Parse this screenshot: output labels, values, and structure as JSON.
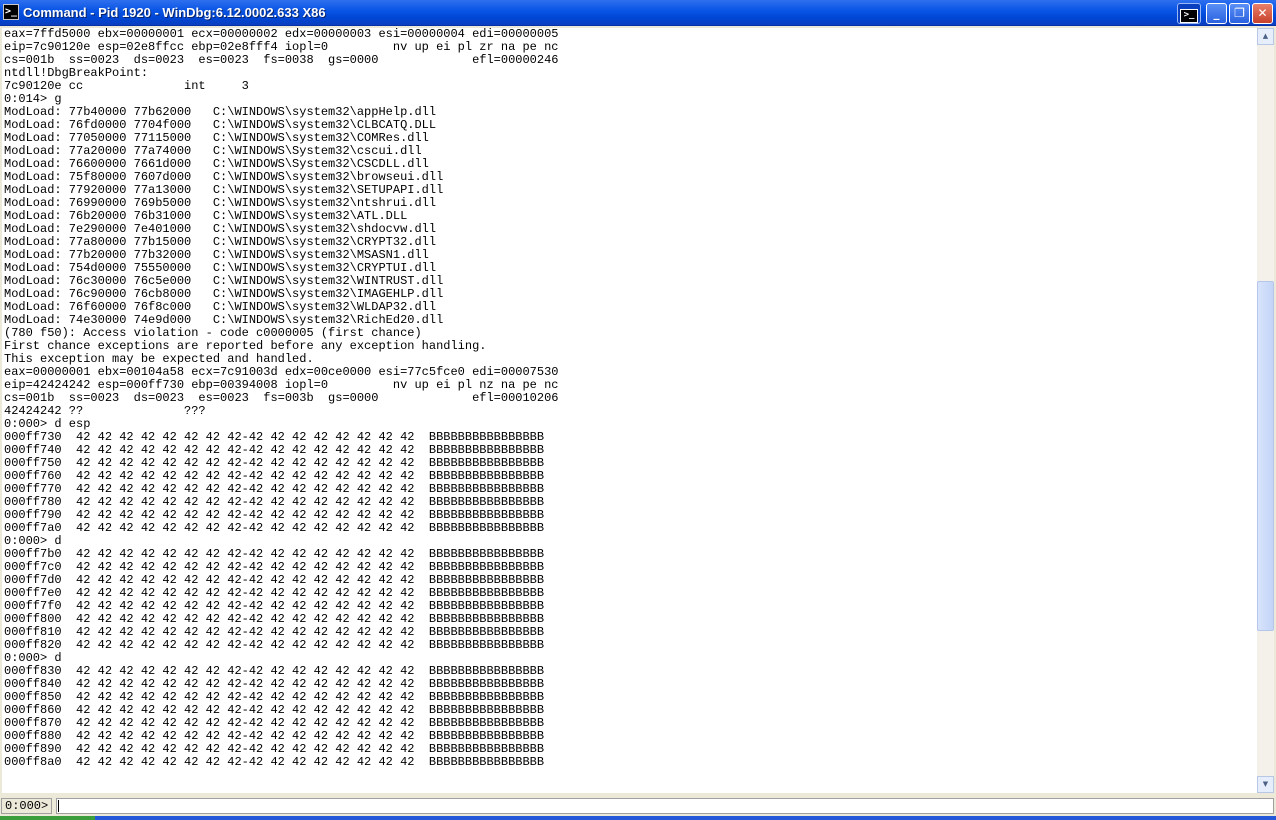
{
  "window": {
    "title": "Command - Pid 1920 - WinDbg:6.12.0002.633 X86",
    "app_icon": "command-prompt-icon"
  },
  "titlebar_buttons": {
    "cmd_glyph": ">_",
    "minimize": "_",
    "maximize": "❐",
    "close": "✕"
  },
  "scrollbar": {
    "up_arrow": "▲",
    "down_arrow": "▼",
    "thumb_position": 0.62
  },
  "output": {
    "lines": [
      "eax=7ffd5000 ebx=00000001 ecx=00000002 edx=00000003 esi=00000004 edi=00000005",
      "eip=7c90120e esp=02e8ffcc ebp=02e8fff4 iopl=0         nv up ei pl zr na pe nc",
      "cs=001b  ss=0023  ds=0023  es=0023  fs=0038  gs=0000             efl=00000246",
      "ntdll!DbgBreakPoint:",
      "7c90120e cc              int     3",
      "0:014> g",
      "ModLoad: 77b40000 77b62000   C:\\WINDOWS\\system32\\appHelp.dll",
      "ModLoad: 76fd0000 7704f000   C:\\WINDOWS\\system32\\CLBCATQ.DLL",
      "ModLoad: 77050000 77115000   C:\\WINDOWS\\system32\\COMRes.dll",
      "ModLoad: 77a20000 77a74000   C:\\WINDOWS\\System32\\cscui.dll",
      "ModLoad: 76600000 7661d000   C:\\WINDOWS\\System32\\CSCDLL.dll",
      "ModLoad: 75f80000 7607d000   C:\\WINDOWS\\system32\\browseui.dll",
      "ModLoad: 77920000 77a13000   C:\\WINDOWS\\system32\\SETUPAPI.dll",
      "ModLoad: 76990000 769b5000   C:\\WINDOWS\\system32\\ntshrui.dll",
      "ModLoad: 76b20000 76b31000   C:\\WINDOWS\\system32\\ATL.DLL",
      "ModLoad: 7e290000 7e401000   C:\\WINDOWS\\system32\\shdocvw.dll",
      "ModLoad: 77a80000 77b15000   C:\\WINDOWS\\system32\\CRYPT32.dll",
      "ModLoad: 77b20000 77b32000   C:\\WINDOWS\\system32\\MSASN1.dll",
      "ModLoad: 754d0000 75550000   C:\\WINDOWS\\system32\\CRYPTUI.dll",
      "ModLoad: 76c30000 76c5e000   C:\\WINDOWS\\system32\\WINTRUST.dll",
      "ModLoad: 76c90000 76cb8000   C:\\WINDOWS\\system32\\IMAGEHLP.dll",
      "ModLoad: 76f60000 76f8c000   C:\\WINDOWS\\system32\\WLDAP32.dll",
      "ModLoad: 74e30000 74e9d000   C:\\WINDOWS\\system32\\RichEd20.dll",
      "(780 f50): Access violation - code c0000005 (first chance)",
      "First chance exceptions are reported before any exception handling.",
      "This exception may be expected and handled.",
      "eax=00000001 ebx=00104a58 ecx=7c91003d edx=00ce0000 esi=77c5fce0 edi=00007530",
      "eip=42424242 esp=000ff730 ebp=00394008 iopl=0         nv up ei pl nz na pe nc",
      "cs=001b  ss=0023  ds=0023  es=0023  fs=003b  gs=0000             efl=00010206",
      "42424242 ??              ???",
      "0:000> d esp",
      "000ff730  42 42 42 42 42 42 42 42-42 42 42 42 42 42 42 42  BBBBBBBBBBBBBBBB",
      "000ff740  42 42 42 42 42 42 42 42-42 42 42 42 42 42 42 42  BBBBBBBBBBBBBBBB",
      "000ff750  42 42 42 42 42 42 42 42-42 42 42 42 42 42 42 42  BBBBBBBBBBBBBBBB",
      "000ff760  42 42 42 42 42 42 42 42-42 42 42 42 42 42 42 42  BBBBBBBBBBBBBBBB",
      "000ff770  42 42 42 42 42 42 42 42-42 42 42 42 42 42 42 42  BBBBBBBBBBBBBBBB",
      "000ff780  42 42 42 42 42 42 42 42-42 42 42 42 42 42 42 42  BBBBBBBBBBBBBBBB",
      "000ff790  42 42 42 42 42 42 42 42-42 42 42 42 42 42 42 42  BBBBBBBBBBBBBBBB",
      "000ff7a0  42 42 42 42 42 42 42 42-42 42 42 42 42 42 42 42  BBBBBBBBBBBBBBBB",
      "0:000> d",
      "000ff7b0  42 42 42 42 42 42 42 42-42 42 42 42 42 42 42 42  BBBBBBBBBBBBBBBB",
      "000ff7c0  42 42 42 42 42 42 42 42-42 42 42 42 42 42 42 42  BBBBBBBBBBBBBBBB",
      "000ff7d0  42 42 42 42 42 42 42 42-42 42 42 42 42 42 42 42  BBBBBBBBBBBBBBBB",
      "000ff7e0  42 42 42 42 42 42 42 42-42 42 42 42 42 42 42 42  BBBBBBBBBBBBBBBB",
      "000ff7f0  42 42 42 42 42 42 42 42-42 42 42 42 42 42 42 42  BBBBBBBBBBBBBBBB",
      "000ff800  42 42 42 42 42 42 42 42-42 42 42 42 42 42 42 42  BBBBBBBBBBBBBBBB",
      "000ff810  42 42 42 42 42 42 42 42-42 42 42 42 42 42 42 42  BBBBBBBBBBBBBBBB",
      "000ff820  42 42 42 42 42 42 42 42-42 42 42 42 42 42 42 42  BBBBBBBBBBBBBBBB",
      "0:000> d",
      "000ff830  42 42 42 42 42 42 42 42-42 42 42 42 42 42 42 42  BBBBBBBBBBBBBBBB",
      "000ff840  42 42 42 42 42 42 42 42-42 42 42 42 42 42 42 42  BBBBBBBBBBBBBBBB",
      "000ff850  42 42 42 42 42 42 42 42-42 42 42 42 42 42 42 42  BBBBBBBBBBBBBBBB",
      "000ff860  42 42 42 42 42 42 42 42-42 42 42 42 42 42 42 42  BBBBBBBBBBBBBBBB",
      "000ff870  42 42 42 42 42 42 42 42-42 42 42 42 42 42 42 42  BBBBBBBBBBBBBBBB",
      "000ff880  42 42 42 42 42 42 42 42-42 42 42 42 42 42 42 42  BBBBBBBBBBBBBBBB",
      "000ff890  42 42 42 42 42 42 42 42-42 42 42 42 42 42 42 42  BBBBBBBBBBBBBBBB",
      "000ff8a0  42 42 42 42 42 42 42 42-42 42 42 42 42 42 42 42  BBBBBBBBBBBBBBBB"
    ]
  },
  "command": {
    "prompt": "0:000>",
    "value": ""
  }
}
